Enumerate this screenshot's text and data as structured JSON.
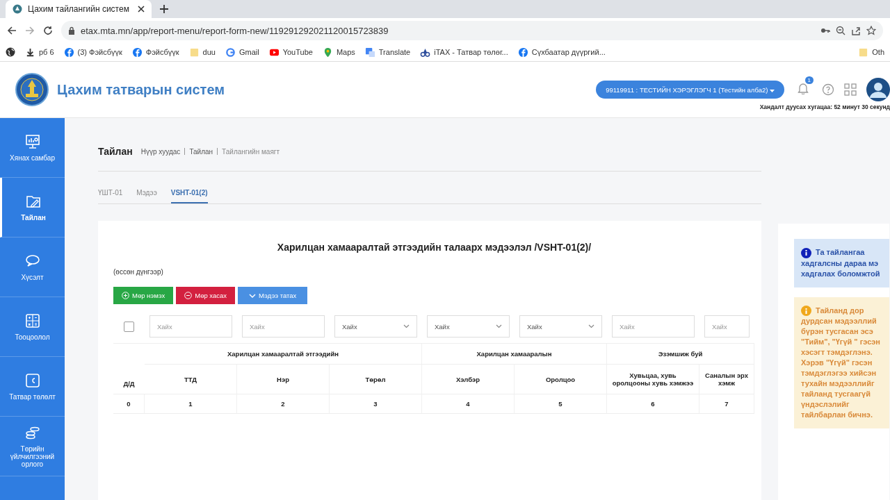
{
  "browser": {
    "tab_title": "Цахим тайлангийн систем",
    "url": "etax.mta.mn/app/report-menu/report-form-new/119291292021120015723839",
    "bookmarks": [
      {
        "label": "рб 6",
        "kind": "download"
      },
      {
        "label": "(3) Фэйсбүүк",
        "kind": "facebook"
      },
      {
        "label": "Фэйсбүүк",
        "kind": "facebook"
      },
      {
        "label": "duu",
        "kind": "folder"
      },
      {
        "label": "Gmail",
        "kind": "google"
      },
      {
        "label": "YouTube",
        "kind": "youtube"
      },
      {
        "label": "Maps",
        "kind": "maps"
      },
      {
        "label": "Translate",
        "kind": "translate"
      },
      {
        "label": "iTAX - Татвар төлөг...",
        "kind": "itax"
      },
      {
        "label": "Сүхбаатар дүүргий...",
        "kind": "facebook"
      }
    ],
    "other_bookmarks": "Oth"
  },
  "header": {
    "title": "Цахим татварын систем",
    "user": "99119911 : ТЕСТИЙН ХЭРЭГЛЭГЧ 1 (Тестийн алба2)",
    "notifications": "1",
    "session": "Хандалт дуусах хугацаа: 52 минут 30 секунд"
  },
  "sidebar": {
    "items": [
      {
        "label": "Хянах самбар",
        "selected": false
      },
      {
        "label": "Тайлан",
        "selected": true
      },
      {
        "label": "Хүсэлт",
        "selected": false
      },
      {
        "label": "Тооцоолол",
        "selected": false
      },
      {
        "label": "Татвар төлөлт",
        "selected": false
      },
      {
        "label": "Төрийн үйлчилгээний орлого",
        "selected": false
      }
    ]
  },
  "page": {
    "title": "Тайлан",
    "breadcrumb": [
      "Нүүр хуудас",
      "Тайлан",
      "Тайлангийн маягт"
    ],
    "tabs": [
      {
        "label": "ҮШТ-01",
        "selected": false
      },
      {
        "label": "Мэдээ",
        "selected": false
      },
      {
        "label": "VSHT-01(2)",
        "selected": true
      }
    ]
  },
  "form": {
    "title": "Харилцан хамааралтай этгээдийн талаарх мэдээлэл /VSHT-01(2)/",
    "subtitle": "(өссөн дүнгээр)",
    "buttons": [
      {
        "label": "Мөр нэмэх",
        "kind": "add"
      },
      {
        "label": "Мөр хасах",
        "kind": "remove"
      },
      {
        "label": "Мэдээ татах",
        "kind": "fetch"
      }
    ],
    "table": {
      "select_all": {
        "checked": false
      },
      "filters": [
        {
          "kind": "text",
          "placeholder": "Хайх"
        },
        {
          "kind": "text",
          "placeholder": "Хайх"
        },
        {
          "kind": "select",
          "value": "Хайх"
        },
        {
          "kind": "select",
          "value": "Хайх"
        },
        {
          "kind": "select",
          "value": "Хайх"
        },
        {
          "kind": "text",
          "placeholder": "Хайх"
        },
        {
          "kind": "text",
          "placeholder": "Хайх"
        }
      ],
      "groups": [
        "Харилцан хамааралтай этгээдийн",
        "Харилцан хамааралын",
        "Эзэмшиж буй"
      ],
      "index_header": "Д/Д",
      "columns": [
        "ТТД",
        "Нэр",
        "Төрөл",
        "Хэлбэр",
        "Оролцоо",
        "Хувьцаа, хувь оролцооны хувь хэмжээ",
        "Саналын эрх хэмж"
      ],
      "numbers": [
        "0",
        "1",
        "2",
        "3",
        "4",
        "5",
        "6",
        "7"
      ]
    }
  },
  "notices": [
    {
      "kind": "info",
      "lines": [
        "Та тайлангаа",
        "хадгалсны дараа мэ",
        "хадгалах боломжтой"
      ]
    },
    {
      "kind": "warning",
      "lines": [
        "Тайланд дор",
        "дурдсан мэдээллий",
        "бүрэн тусгасан эсэ",
        "\"Тийм\", \"Үгүй \" гэсэн",
        "хэсэгт тэмдэглэнэ.",
        "Хэрэв \"Үгүй\" гэсэн",
        "тэмдэглэгээ хийсэн",
        "тухайн мэдээллийг",
        "тайланд тусгаагүй",
        "үндэслэлийг",
        "тайлбарлан бичнэ."
      ]
    }
  ]
}
